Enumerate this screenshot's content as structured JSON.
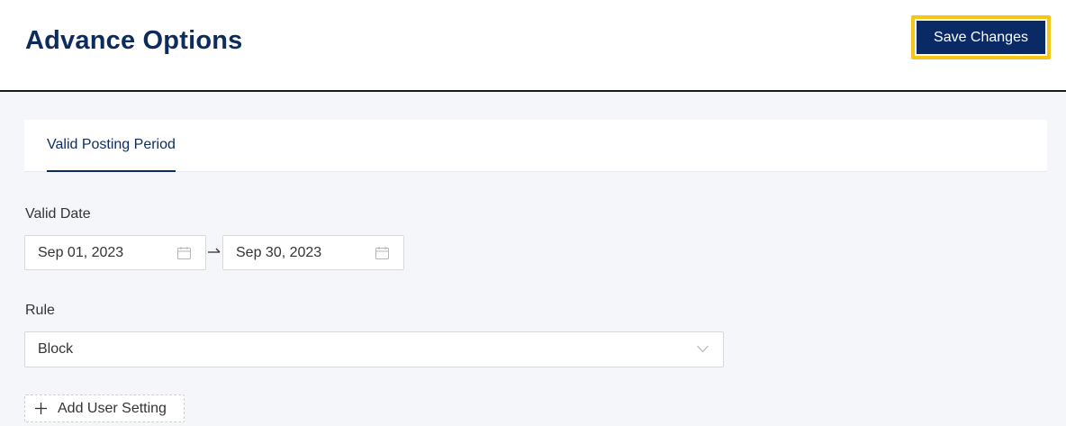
{
  "header": {
    "title": "Advance Options",
    "save_label": "Save Changes"
  },
  "tabs": [
    {
      "label": "Valid Posting Period",
      "active": true
    }
  ],
  "valid_date": {
    "label": "Valid Date",
    "start": "Sep 01, 2023",
    "end": "Sep 30, 2023",
    "icon": "calendar-icon"
  },
  "rule": {
    "label": "Rule",
    "value": "Block",
    "icon": "chevron-down-icon"
  },
  "add_user_setting": {
    "label": "Add User Setting",
    "icon": "plus-icon"
  },
  "colors": {
    "primary": "#0a2a66",
    "focus_ring": "#f5c518",
    "background": "#f5f6fa"
  }
}
